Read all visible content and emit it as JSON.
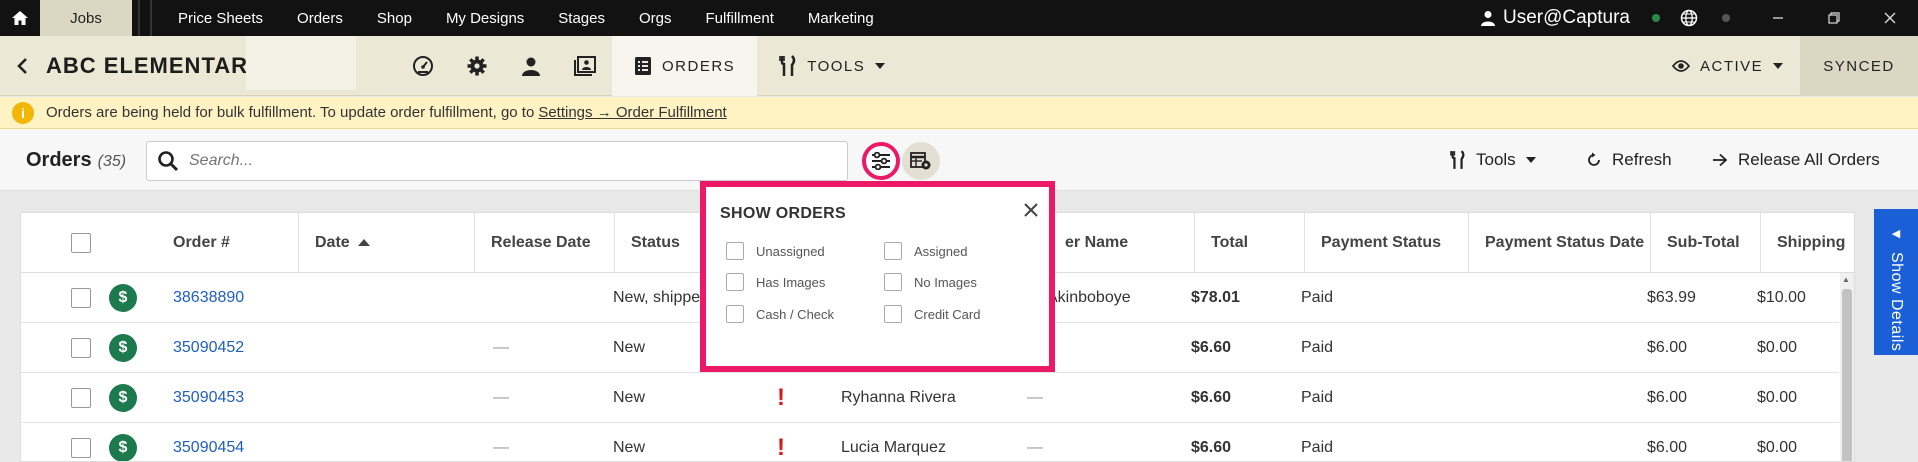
{
  "topnav": {
    "active_tab": "Jobs",
    "items": [
      "Price Sheets",
      "Orders",
      "Shop",
      "My Designs",
      "Stages",
      "Orgs",
      "Fulfillment",
      "Marketing"
    ],
    "user": "User@Captura"
  },
  "jobbar": {
    "title": "ABC ELEMENTARY",
    "orders_tab": "ORDERS",
    "tools_tab": "TOOLS",
    "status": "ACTIVE",
    "synced": "SYNCED"
  },
  "notice": {
    "text": "Orders are being held for bulk fulfillment. To update order fulfillment, go to",
    "link": "Settings → Order Fulfillment"
  },
  "orders": {
    "title": "Orders",
    "count": "(35)",
    "search_placeholder": "Search...",
    "tools_label": "Tools",
    "refresh_label": "Refresh",
    "release_label": "Release All Orders"
  },
  "table": {
    "headers": {
      "order": "Order #",
      "date": "Date",
      "release_date": "Release Date",
      "status": "Status",
      "name": "er Name",
      "total": "Total",
      "payment_status": "Payment Status",
      "payment_status_date": "Payment Status Date",
      "subtotal": "Sub-Total",
      "shipping": "Shipping"
    },
    "rows": [
      {
        "order": "38638890",
        "release": "",
        "status": "New, shippe",
        "name": "Akinboboye",
        "name_dash": "",
        "total": "$78.01",
        "payment": "Paid",
        "subtotal": "$63.99",
        "shipping": "$10.00"
      },
      {
        "order": "35090452",
        "release": "—",
        "status": "New",
        "name": "",
        "name_dash": "",
        "total": "$6.60",
        "payment": "Paid",
        "subtotal": "$6.00",
        "shipping": "$0.00"
      },
      {
        "order": "35090453",
        "release": "—",
        "status": "New",
        "alert": "!",
        "name": "Ryhanna Rivera",
        "name_dash": "—",
        "total": "$6.60",
        "payment": "Paid",
        "subtotal": "$6.00",
        "shipping": "$0.00"
      },
      {
        "order": "35090454",
        "release": "—",
        "status": "New",
        "alert": "!",
        "name": "Lucia Marquez",
        "name_dash": "—",
        "total": "$6.60",
        "payment": "Paid",
        "subtotal": "$6.00",
        "shipping": "$0.00"
      }
    ]
  },
  "show_details": "Show Details",
  "popover": {
    "title": "SHOW ORDERS",
    "options": [
      "Unassigned",
      "Assigned",
      "Has Images",
      "No Images",
      "Cash / Check",
      "Credit Card"
    ]
  },
  "colors": {
    "accent_pink": "#ec1a66",
    "link_blue": "#1f5fbf",
    "paid_green": "#1d7a4e",
    "details_blue": "#1a5fd6"
  }
}
